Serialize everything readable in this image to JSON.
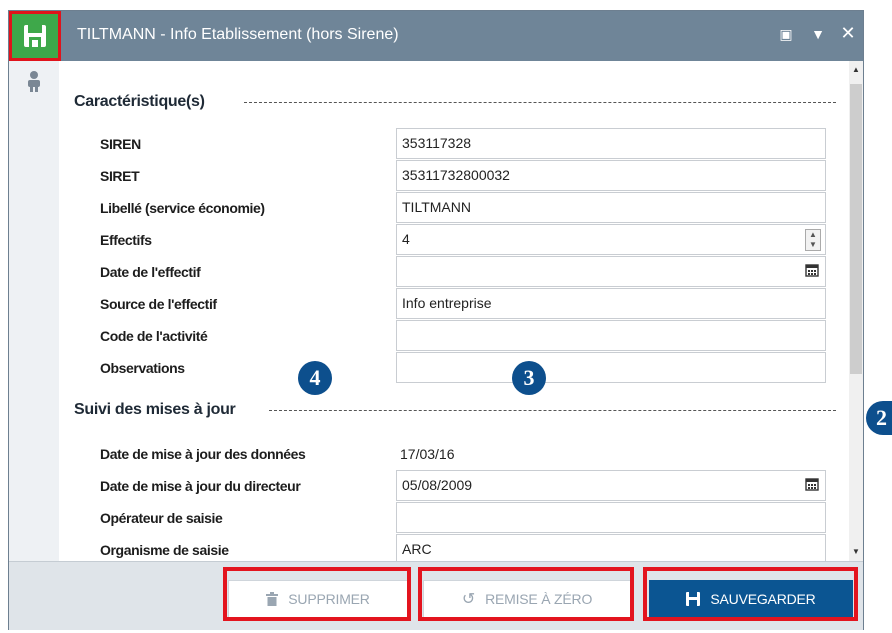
{
  "window": {
    "title": "TILTMANN - Info Etablissement (hors Sirene)"
  },
  "titlebar_buttons": [
    "restore-icon",
    "dropdown-icon",
    "close-icon"
  ],
  "sections": {
    "caracteristiques": "Caractéristique(s)",
    "suivi": "Suivi des mises à jour"
  },
  "fields": {
    "siren": {
      "label": "SIREN",
      "value": "353117328"
    },
    "siret": {
      "label": "SIRET",
      "value": "35311732800032"
    },
    "libelle": {
      "label": "Libellé (service économie)",
      "value": "TILTMANN"
    },
    "effectifs": {
      "label": "Effectifs",
      "value": "4"
    },
    "date_effectif": {
      "label": "Date de l'effectif",
      "value": ""
    },
    "source_effectif": {
      "label": "Source de l'effectif",
      "value": "Info entreprise"
    },
    "code_activite": {
      "label": "Code de l'activité",
      "value": ""
    },
    "observations": {
      "label": "Observations",
      "value": ""
    },
    "date_maj_donnees": {
      "label": "Date de mise à jour des données",
      "value": "17/03/16"
    },
    "date_maj_directeur": {
      "label": "Date de mise à jour du directeur",
      "value": "05/08/2009"
    },
    "operateur": {
      "label": "Opérateur de saisie",
      "value": ""
    },
    "organisme": {
      "label": "Organisme de saisie",
      "value": "ARC"
    }
  },
  "buttons": {
    "supprimer": "SUPPRIMER",
    "remise": "REMISE À ZÉRO",
    "sauvegarder": "SAUVEGARDER"
  },
  "markers": [
    "4",
    "3",
    "2"
  ],
  "colors": {
    "titlebar": "#6f8598",
    "accent": "#0b5592",
    "highlight": "#e3141e",
    "save_icon": "#3ea84a"
  }
}
